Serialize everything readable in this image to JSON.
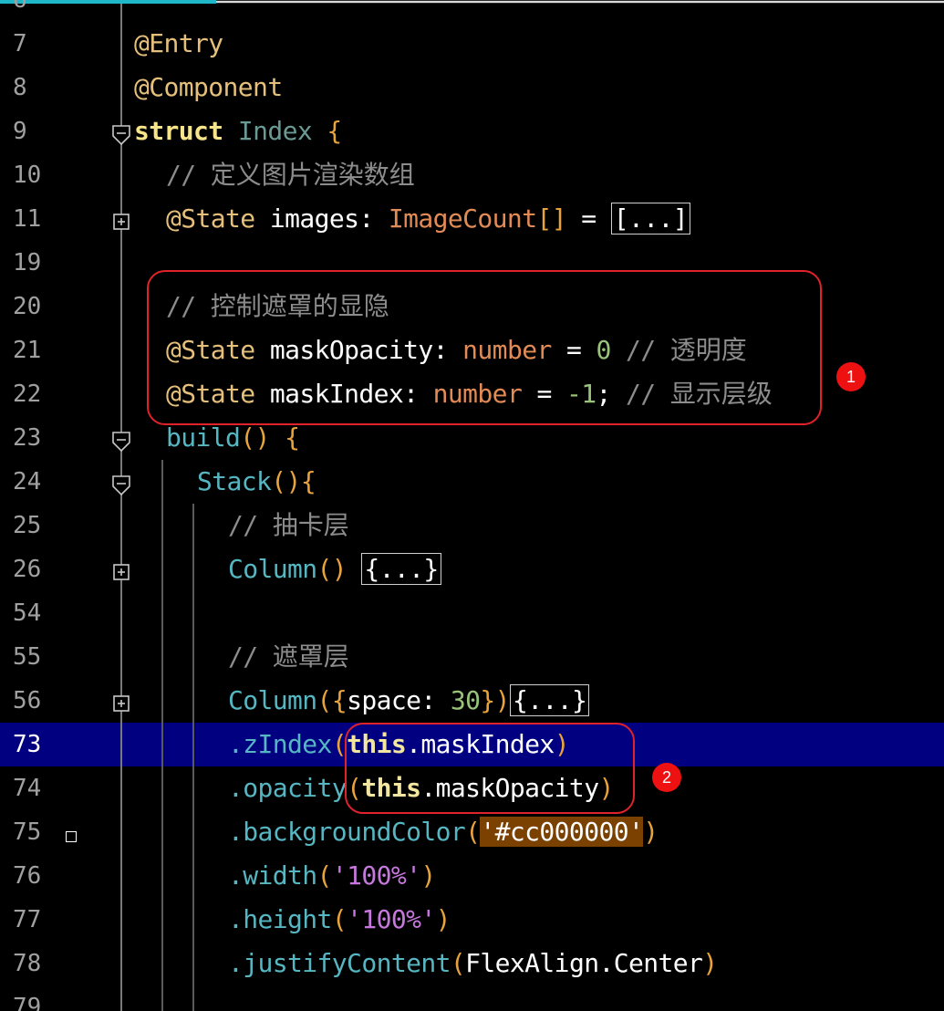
{
  "editor": {
    "partial_top_number": "6",
    "partial_bottom_number": "79",
    "lines": [
      {
        "n": "7",
        "parts": [
          {
            "c": "tok-ann",
            "t": "@Entry"
          }
        ]
      },
      {
        "n": "8",
        "parts": [
          {
            "c": "tok-ann",
            "t": "@Component"
          }
        ]
      },
      {
        "n": "9",
        "parts": [
          {
            "c": "tok-kw",
            "t": "struct "
          },
          {
            "c": "tok-ty",
            "t": "Index "
          },
          {
            "c": "tok-brace",
            "t": "{"
          }
        ]
      },
      {
        "n": "10",
        "parts": [
          {
            "c": "tok-cm",
            "t": "// "
          },
          {
            "c": "tok-cm comment",
            "t": "定义图片渲染数组"
          }
        ]
      },
      {
        "n": "11",
        "parts": [
          {
            "c": "tok-ann",
            "t": "@State "
          },
          {
            "c": "tok-op",
            "t": "images: "
          },
          {
            "c": "tok-type",
            "t": "ImageCount"
          },
          {
            "c": "tok-paren",
            "t": "[]"
          },
          {
            "c": "tok-op",
            "t": " = "
          },
          {
            "c": "tok-op fold-box",
            "t": "[...]"
          }
        ]
      },
      {
        "n": "19",
        "parts": []
      },
      {
        "n": "20",
        "parts": [
          {
            "c": "tok-cm",
            "t": "// "
          },
          {
            "c": "tok-cm comment",
            "t": "控制遮罩的显隐"
          }
        ]
      },
      {
        "n": "21",
        "parts": [
          {
            "c": "tok-ann",
            "t": "@State "
          },
          {
            "c": "tok-op",
            "t": "maskOpacity: "
          },
          {
            "c": "tok-type",
            "t": "number"
          },
          {
            "c": "tok-op",
            "t": " = "
          },
          {
            "c": "tok-num",
            "t": "0"
          },
          {
            "c": "tok-cm",
            "t": " // "
          },
          {
            "c": "tok-cm comment",
            "t": "透明度"
          }
        ]
      },
      {
        "n": "22",
        "parts": [
          {
            "c": "tok-ann",
            "t": "@State "
          },
          {
            "c": "tok-op",
            "t": "maskIndex: "
          },
          {
            "c": "tok-type",
            "t": "number"
          },
          {
            "c": "tok-op",
            "t": " = "
          },
          {
            "c": "tok-num",
            "t": "-1"
          },
          {
            "c": "tok-op",
            "t": ";"
          },
          {
            "c": "tok-cm",
            "t": " // "
          },
          {
            "c": "tok-cm comment",
            "t": "显示层级"
          }
        ]
      },
      {
        "n": "23",
        "parts": [
          {
            "c": "tok-fn",
            "t": "build"
          },
          {
            "c": "tok-paren",
            "t": "()"
          },
          {
            "c": "tok-op",
            "t": " "
          },
          {
            "c": "tok-brace",
            "t": "{"
          }
        ]
      },
      {
        "n": "24",
        "parts": [
          {
            "c": "tok-fn",
            "t": "Stack"
          },
          {
            "c": "tok-paren",
            "t": "()"
          },
          {
            "c": "tok-brace",
            "t": "{"
          }
        ]
      },
      {
        "n": "25",
        "parts": [
          {
            "c": "tok-cm",
            "t": "// "
          },
          {
            "c": "tok-cm comment",
            "t": "抽卡层"
          }
        ]
      },
      {
        "n": "26",
        "parts": [
          {
            "c": "tok-fn",
            "t": "Column"
          },
          {
            "c": "tok-paren",
            "t": "()"
          },
          {
            "c": "tok-op",
            "t": " "
          },
          {
            "c": "tok-op fold-box",
            "t": "{...}"
          }
        ]
      },
      {
        "n": "54",
        "parts": []
      },
      {
        "n": "55",
        "parts": [
          {
            "c": "tok-cm",
            "t": "// "
          },
          {
            "c": "tok-cm comment",
            "t": "遮罩层"
          }
        ]
      },
      {
        "n": "56",
        "parts": [
          {
            "c": "tok-fn",
            "t": "Column"
          },
          {
            "c": "tok-paren",
            "t": "("
          },
          {
            "c": "tok-brace",
            "t": "{"
          },
          {
            "c": "tok-op",
            "t": "space: "
          },
          {
            "c": "tok-num",
            "t": "30"
          },
          {
            "c": "tok-brace",
            "t": "}"
          },
          {
            "c": "tok-paren",
            "t": ")"
          },
          {
            "c": "tok-op fold-box",
            "t": "{...}"
          }
        ]
      },
      {
        "n": "73",
        "parts": [
          {
            "c": "tok-fn",
            "t": ".zIndex"
          },
          {
            "c": "tok-paren",
            "t": "("
          },
          {
            "c": "tok-this",
            "t": "this"
          },
          {
            "c": "tok-op",
            "t": ".maskIndex"
          },
          {
            "c": "tok-paren",
            "t": ")"
          }
        ]
      },
      {
        "n": "74",
        "parts": [
          {
            "c": "tok-fn",
            "t": ".opacity"
          },
          {
            "c": "tok-paren",
            "t": "("
          },
          {
            "c": "tok-this",
            "t": "this"
          },
          {
            "c": "tok-op",
            "t": ".maskOpacity"
          },
          {
            "c": "tok-paren",
            "t": ")"
          }
        ]
      },
      {
        "n": "75",
        "parts": [
          {
            "c": "tok-fn",
            "t": ".backgroundColor"
          },
          {
            "c": "tok-paren",
            "t": "("
          },
          {
            "c": "tok-op strhl",
            "t": "'#cc000000'"
          },
          {
            "c": "tok-paren",
            "t": ")"
          }
        ]
      },
      {
        "n": "76",
        "parts": [
          {
            "c": "tok-fn",
            "t": ".width"
          },
          {
            "c": "tok-paren",
            "t": "("
          },
          {
            "c": "tok-str",
            "t": "'100%'"
          },
          {
            "c": "tok-paren",
            "t": ")"
          }
        ]
      },
      {
        "n": "77",
        "parts": [
          {
            "c": "tok-fn",
            "t": ".height"
          },
          {
            "c": "tok-paren",
            "t": "("
          },
          {
            "c": "tok-str",
            "t": "'100%'"
          },
          {
            "c": "tok-paren",
            "t": ")"
          }
        ]
      },
      {
        "n": "78",
        "parts": [
          {
            "c": "tok-fn",
            "t": ".justifyContent"
          },
          {
            "c": "tok-paren",
            "t": "("
          },
          {
            "c": "tok-op",
            "t": "FlexAlign.Center"
          },
          {
            "c": "tok-paren",
            "t": ")"
          }
        ]
      }
    ]
  },
  "annotations": {
    "badge_1": "1",
    "badge_2": "2"
  },
  "colors": {
    "background": "#000000",
    "current_line": "#000080",
    "annotation_red": "#e0222a",
    "annotation_badge": "#ee1111"
  }
}
